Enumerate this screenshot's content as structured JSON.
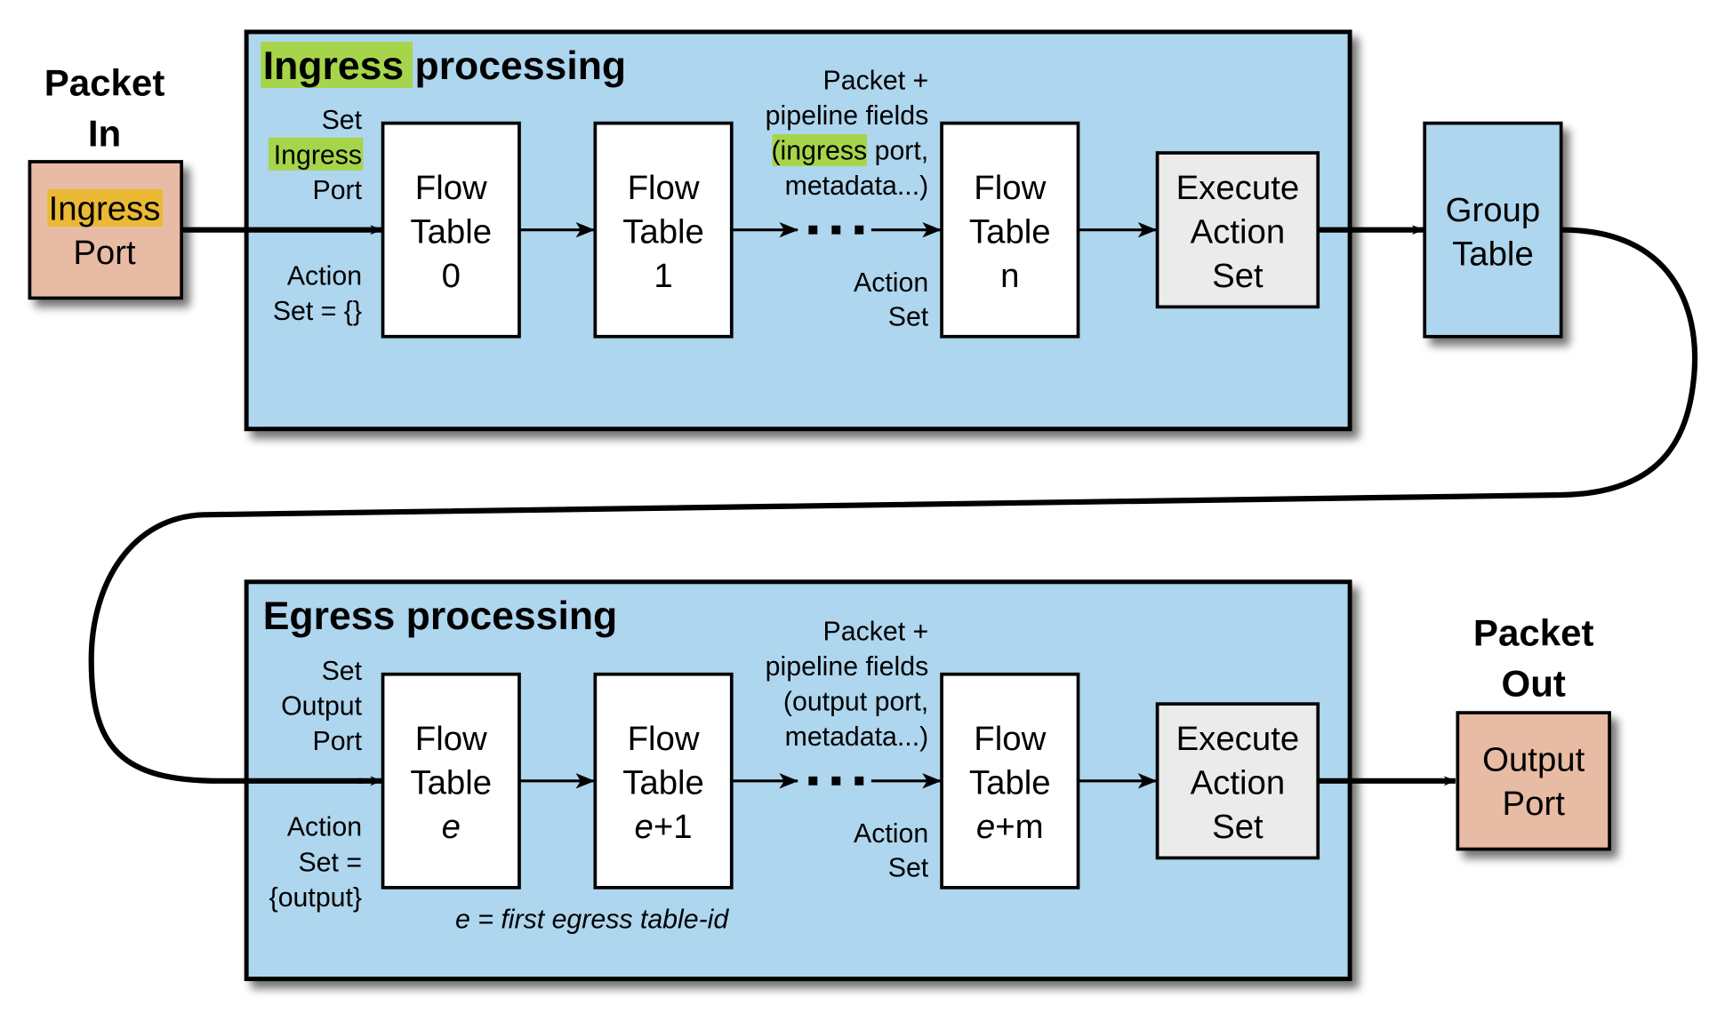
{
  "colors": {
    "panel_fill": "#AED6EE",
    "flow_table_fill": "#FFFFFF",
    "execute_fill": "#EBEBEB",
    "port_fill": "#E8BBA4",
    "group_fill": "#AED6EE",
    "highlight_green": "#A6D54B",
    "highlight_orange": "#EBB934",
    "line": "#000000"
  },
  "packet_in": {
    "heading": [
      "Packet",
      "In"
    ],
    "port": [
      "Ingress",
      "Port"
    ]
  },
  "ingress": {
    "title_highlight": "Ingress",
    "title_rest": " processing",
    "set_label": [
      "Set",
      "Ingress",
      "Port"
    ],
    "action_label": [
      "Action",
      "Set = {}"
    ],
    "tables": [
      {
        "line1": "Flow",
        "line2": "Table",
        "line3": "0"
      },
      {
        "line1": "Flow",
        "line2": "Table",
        "line3": "1"
      },
      {
        "line1": "Flow",
        "line2": "Table",
        "line3": "n"
      }
    ],
    "pipeline_label": {
      "line1": "Packet +",
      "line2": "pipeline fields",
      "line3_open": "(",
      "line3_highlight": "ingress",
      "line3_rest": " port,",
      "line4": "metadata...)"
    },
    "action_set_label": [
      "Action",
      "Set"
    ],
    "dots": "· · ·",
    "execute": [
      "Execute",
      "Action",
      "Set"
    ]
  },
  "group_table": [
    "Group",
    "Table"
  ],
  "egress": {
    "title": "Egress processing",
    "set_label": [
      "Set",
      "Output",
      "Port"
    ],
    "action_label": [
      "Action",
      "Set =",
      "{output}"
    ],
    "tables": [
      {
        "line1": "Flow",
        "line2": "Table",
        "var": "e",
        "suffix": ""
      },
      {
        "line1": "Flow",
        "line2": "Table",
        "var": "e",
        "suffix": "+1"
      },
      {
        "line1": "Flow",
        "line2": "Table",
        "var": "e",
        "suffix": "+m"
      }
    ],
    "pipeline_label": [
      "Packet +",
      "pipeline fields",
      "(output port,",
      "metadata...)"
    ],
    "action_set_label": [
      "Action",
      "Set"
    ],
    "dots": "· · ·",
    "execute": [
      "Execute",
      "Action",
      "Set"
    ],
    "footnote": "e = first egress table-id"
  },
  "packet_out": {
    "heading": [
      "Packet",
      "Out"
    ],
    "port": [
      "Output",
      "Port"
    ]
  }
}
